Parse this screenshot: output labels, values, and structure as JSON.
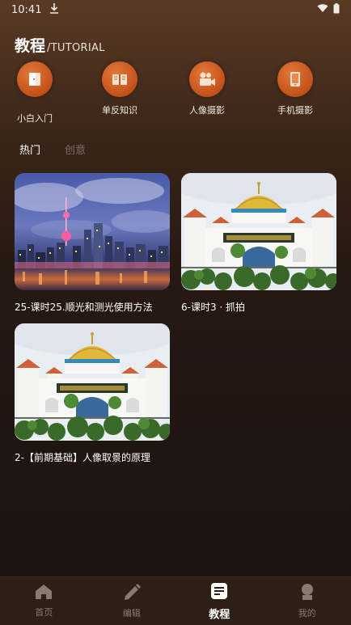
{
  "status_bar": {
    "time": "10:41"
  },
  "header": {
    "title": "教程",
    "subtitle": "/TUTORIAL"
  },
  "categories": [
    {
      "label": "小白入门",
      "icon": "door-icon"
    },
    {
      "label": "单反知识",
      "icon": "book-icon"
    },
    {
      "label": "人像摄影",
      "icon": "video-camera-icon"
    },
    {
      "label": "手机摄影",
      "icon": "phone-icon"
    }
  ],
  "tabs": [
    {
      "label": "热门",
      "active": true
    },
    {
      "label": "创意",
      "active": false
    }
  ],
  "cards": [
    {
      "title": "25-课时25.顺光和测光使用方法",
      "image": "city-night-skyline"
    },
    {
      "title": "6-课时3 · 抓拍",
      "image": "mosque-golden-dome"
    },
    {
      "title": "2-【前期基础】人像取景的原理",
      "image": "mosque-golden-dome"
    }
  ],
  "bottom_nav": [
    {
      "label": "首页",
      "icon": "home-icon",
      "active": false
    },
    {
      "label": "编辑",
      "icon": "pencil-icon",
      "active": false
    },
    {
      "label": "教程",
      "icon": "tutorial-icon",
      "active": true
    },
    {
      "label": "我的",
      "icon": "person-icon",
      "active": false
    }
  ],
  "colors": {
    "accent": "#d0601e",
    "background": "#1c1410",
    "nav_bg": "#2d1f16"
  }
}
